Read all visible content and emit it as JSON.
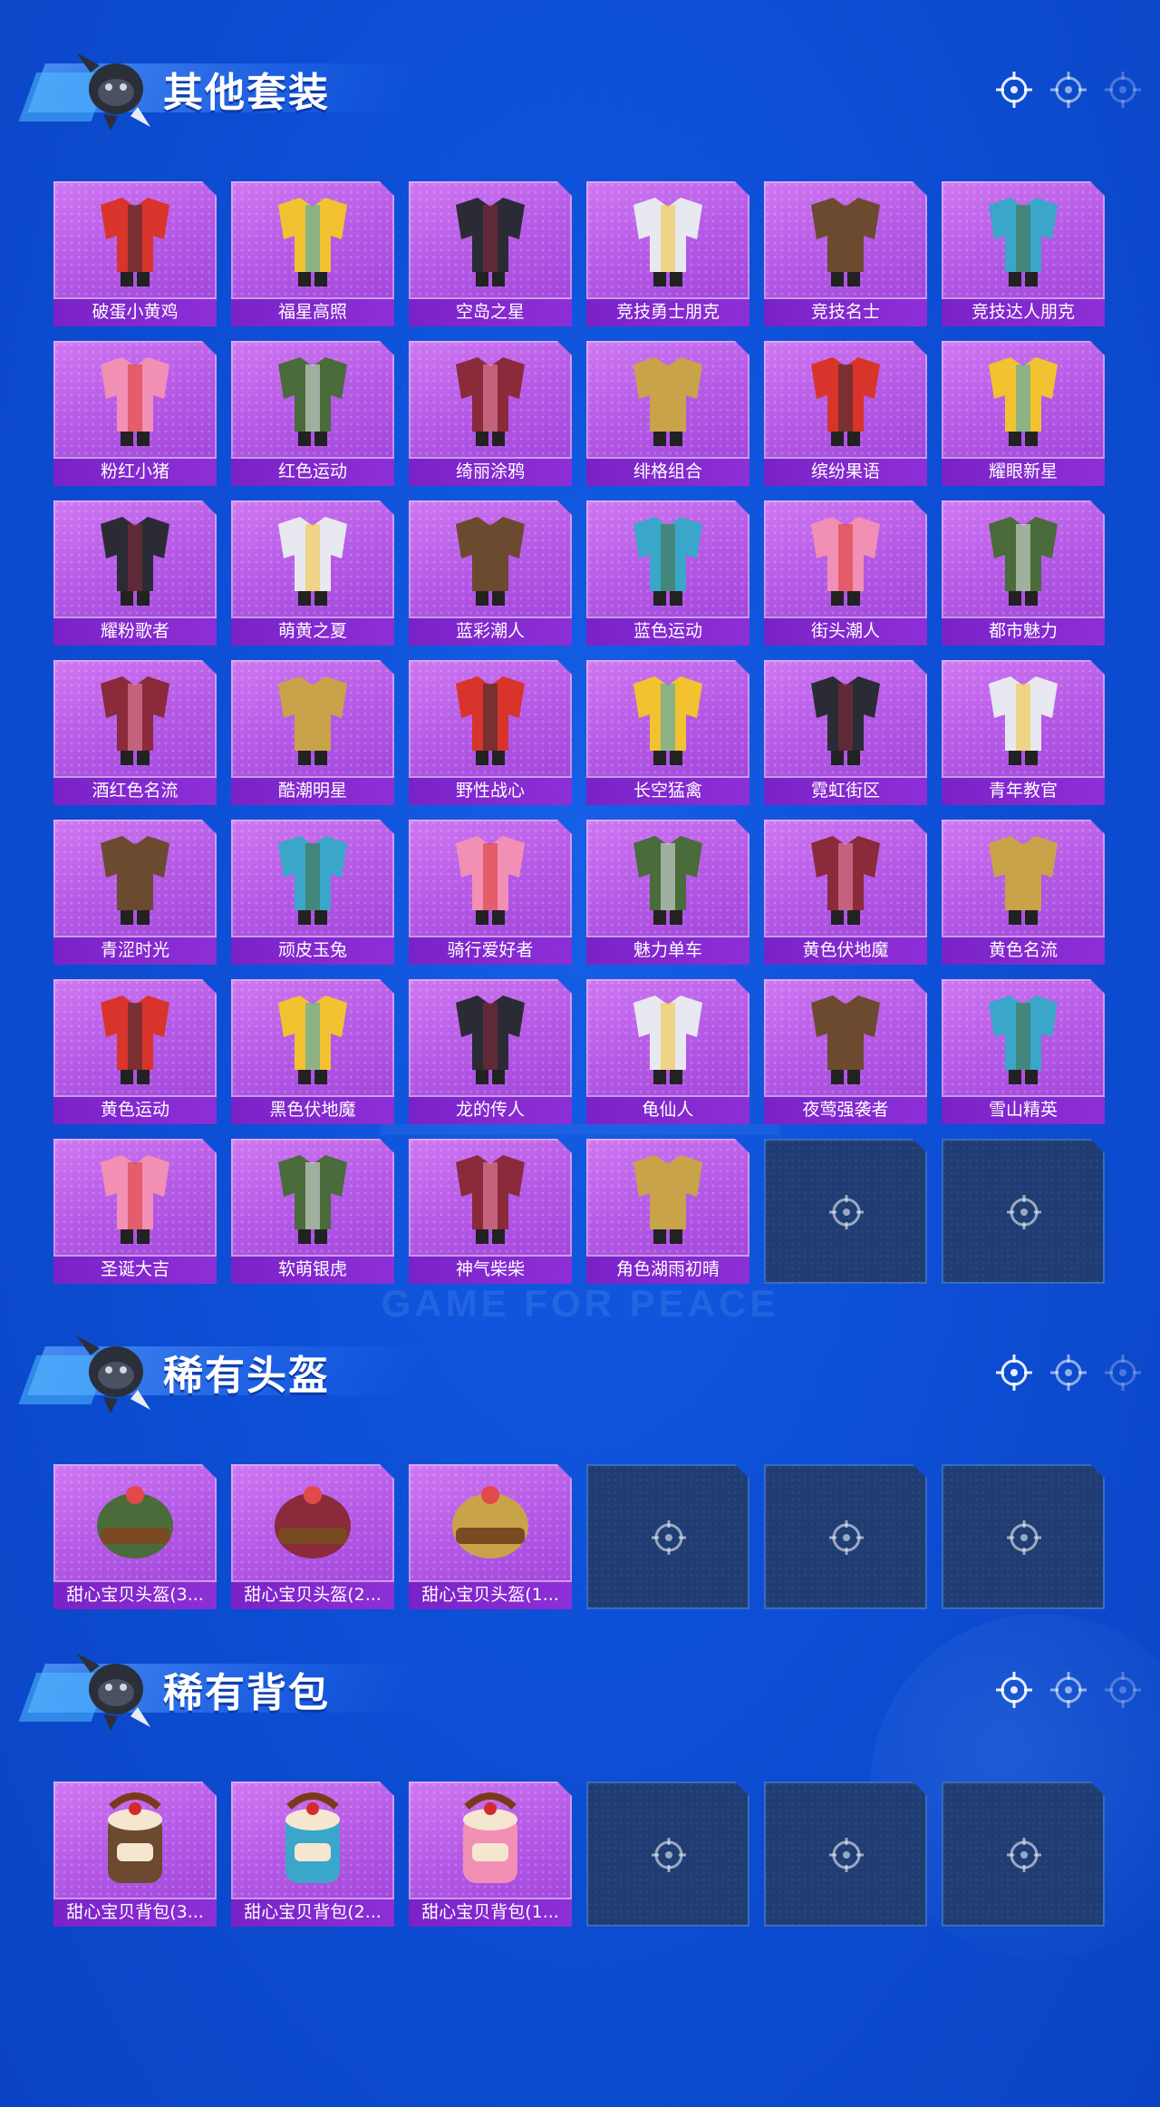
{
  "watermark": "GAME FOR PEACE",
  "sections": [
    {
      "title": "其他套装",
      "items": [
        "破蛋小黄鸡",
        "福星高照",
        "空岛之星",
        "竞技勇士朋克",
        "竞技名士",
        "竞技达人朋克",
        "粉红小猪",
        "红色运动",
        "绮丽涂鸦",
        "绯格组合",
        "缤纷果语",
        "耀眼新星",
        "耀粉歌者",
        "萌黄之夏",
        "蓝彩潮人",
        "蓝色运动",
        "街头潮人",
        "都市魅力",
        "酒红色名流",
        "酷潮明星",
        "野性战心",
        "长空猛禽",
        "霓虹街区",
        "青年教官",
        "青涩时光",
        "顽皮玉兔",
        "骑行爱好者",
        "魅力单车",
        "黄色伏地魔",
        "黄色名流",
        "黄色运动",
        "黑色伏地魔",
        "龙的传人",
        "龟仙人",
        "夜莺强袭者",
        "雪山精英",
        "圣诞大吉",
        "软萌银虎",
        "神气柴柴",
        "角色湖雨初晴"
      ],
      "empty_slots": 2
    },
    {
      "title": "稀有头盔",
      "items": [
        "甜心宝贝头盔(3...",
        "甜心宝贝头盔(2...",
        "甜心宝贝头盔(1..."
      ],
      "empty_slots": 3
    },
    {
      "title": "稀有背包",
      "items": [
        "甜心宝贝背包(3...",
        "甜心宝贝背包(2...",
        "甜心宝贝背包(1..."
      ],
      "empty_slots": 3
    }
  ],
  "colors": {
    "background": "#0d4fd6",
    "tile_filled": "#b55ae6",
    "tile_label": "#7a22c8",
    "tile_empty": "#1f3d73"
  },
  "icons": [
    "mascot-icon",
    "crosshair-icon"
  ]
}
